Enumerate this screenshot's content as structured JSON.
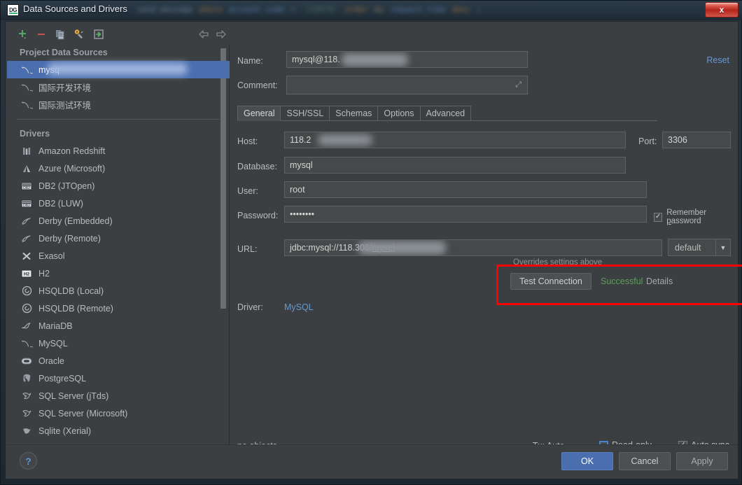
{
  "window": {
    "title": "Data Sources and Drivers",
    "app_icon": "datagrip-icon",
    "close_label": "x",
    "background_blur_tokens": [
      "send_message",
      "where",
      "account_code",
      "=",
      "'118579'",
      "order",
      "by",
      "request_time",
      "desc",
      ";"
    ]
  },
  "toolbar": {
    "items": [
      {
        "name": "add-data-source-button",
        "icon": "plus-icon",
        "tooltip": "Add"
      },
      {
        "name": "remove-data-source-button",
        "icon": "minus-icon",
        "tooltip": "Remove"
      },
      {
        "name": "duplicate-data-source-button",
        "icon": "copy-icon",
        "tooltip": "Duplicate"
      },
      {
        "name": "edit-driver-button",
        "icon": "wrench-icon",
        "tooltip": "Driver settings"
      },
      {
        "name": "import-data-source-button",
        "icon": "import-icon",
        "tooltip": "Import"
      },
      {
        "name": "nav-back-button",
        "icon": "arrow-left-icon",
        "tooltip": "Back"
      },
      {
        "name": "nav-forward-button",
        "icon": "arrow-right-icon",
        "tooltip": "Forward"
      }
    ]
  },
  "sidebar": {
    "project_header": "Project Data Sources",
    "data_sources": [
      {
        "label": "mysq",
        "redacted": true,
        "selected": true,
        "icon": "mysql-dolphin-icon"
      },
      {
        "label": "国际开发环境",
        "redacted": false,
        "selected": false,
        "icon": "mysql-dolphin-icon"
      },
      {
        "label": "国际测试环境",
        "redacted": false,
        "selected": false,
        "icon": "mysql-dolphin-icon"
      }
    ],
    "drivers_header": "Drivers",
    "drivers": [
      {
        "label": "Amazon Redshift",
        "icon": "redshift-icon"
      },
      {
        "label": "Azure (Microsoft)",
        "icon": "azure-icon"
      },
      {
        "label": "DB2 (JTOpen)",
        "icon": "db2-icon"
      },
      {
        "label": "DB2 (LUW)",
        "icon": "db2-icon"
      },
      {
        "label": "Derby (Embedded)",
        "icon": "derby-icon"
      },
      {
        "label": "Derby (Remote)",
        "icon": "derby-icon"
      },
      {
        "label": "Exasol",
        "icon": "exasol-icon"
      },
      {
        "label": "H2",
        "icon": "h2-icon"
      },
      {
        "label": "HSQLDB (Local)",
        "icon": "hsqldb-icon"
      },
      {
        "label": "HSQLDB (Remote)",
        "icon": "hsqldb-icon"
      },
      {
        "label": "MariaDB",
        "icon": "mariadb-seal-icon"
      },
      {
        "label": "MySQL",
        "icon": "mysql-dolphin-icon"
      },
      {
        "label": "Oracle",
        "icon": "oracle-icon"
      },
      {
        "label": "PostgreSQL",
        "icon": "postgresql-elephant-icon"
      },
      {
        "label": "SQL Server (jTds)",
        "icon": "sqlserver-icon"
      },
      {
        "label": "SQL Server (Microsoft)",
        "icon": "sqlserver-icon"
      },
      {
        "label": "Sqlite (Xerial)",
        "icon": "sqlite-icon"
      }
    ]
  },
  "details": {
    "name_label": "Name:",
    "name_value": "mysql@118.",
    "comment_label": "Comment:",
    "comment_value": "",
    "reset_label": "Reset",
    "tabs": [
      {
        "label": "General",
        "active": true
      },
      {
        "label": "SSH/SSL",
        "active": false
      },
      {
        "label": "Schemas",
        "active": false
      },
      {
        "label": "Options",
        "active": false
      },
      {
        "label": "Advanced",
        "active": false
      }
    ],
    "host_label": "Host:",
    "host_value": "118.2",
    "port_label": "Port:",
    "port_value": "3306",
    "database_label": "Database:",
    "database_value": "mysql",
    "user_label": "User:",
    "user_value": "root",
    "password_label": "Password:",
    "password_value": "••••••••",
    "remember_password_label": "Remember password",
    "remember_password_checked": true,
    "url_label": "URL:",
    "url_value_prefix": "jdbc:mysql://118.",
    "url_value_suffix": "306/",
    "url_value_db": "mysql",
    "url_mode": "default",
    "url_hint": "Overrides settings above",
    "test_connection_label": "Test Connection",
    "test_status": "Successful",
    "test_details_label": "Details",
    "driver_label": "Driver:",
    "driver_value": "MySQL",
    "highlight_color": "#ff0000"
  },
  "statusbar": {
    "objects_text": "no objects",
    "tx_label": "Tx: Auto",
    "readonly_label": "Read-only",
    "readonly_checked": false,
    "autosync_label": "Auto sync",
    "autosync_checked": true
  },
  "footer": {
    "help_label": "?",
    "ok_label": "OK",
    "cancel_label": "Cancel",
    "apply_label": "Apply"
  }
}
